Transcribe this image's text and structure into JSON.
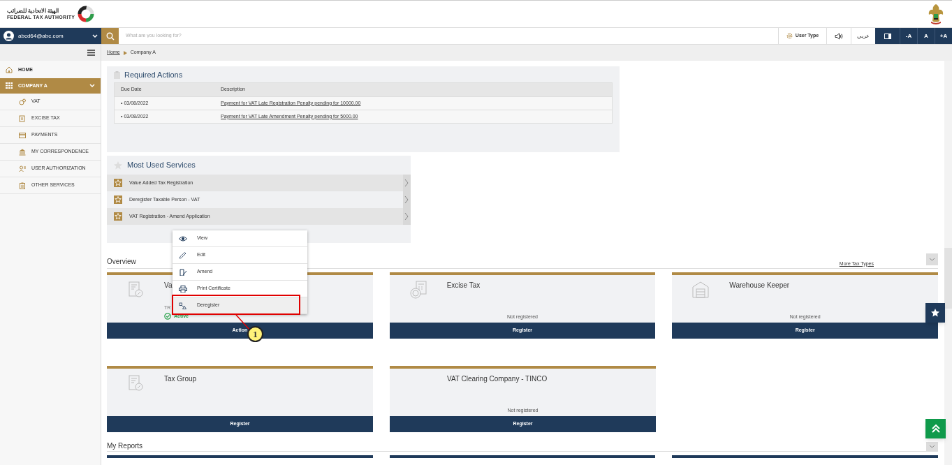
{
  "header": {
    "logo_arabic": "الهيئة الاتحادية للضرائب",
    "logo_english": "FEDERAL TAX AUTHORITY"
  },
  "user": {
    "email": "abcd64@abc.com"
  },
  "search": {
    "placeholder": "What are you looking for?"
  },
  "toolbar": {
    "user_type": "User Type",
    "language": "عربي",
    "font_buttons": [
      "-A",
      "A",
      "+A"
    ]
  },
  "breadcrumb": [
    "Home",
    "Company A"
  ],
  "sidebar": {
    "items": [
      {
        "label": "HOME",
        "selected": false
      },
      {
        "label": "COMPANY A",
        "selected": true,
        "expanded": true,
        "children": [
          {
            "label": "VAT"
          },
          {
            "label": "EXCISE TAX"
          },
          {
            "label": "PAYMENTS"
          },
          {
            "label": "MY CORRESPONDENCE"
          },
          {
            "label": "USER AUTHORIZATION"
          },
          {
            "label": "OTHER SERVICES"
          }
        ]
      }
    ]
  },
  "required_actions": {
    "title": "Required Actions",
    "columns": [
      "Due Date",
      "Description"
    ],
    "rows": [
      {
        "due_date": "• 03/08/2022",
        "description": "Payment for VAT Late Registration Penalty pending for 10000.00"
      },
      {
        "due_date": "• 03/08/2022",
        "description": "Payment for VAT Late Amendment Penalty pending for 5000.00"
      }
    ]
  },
  "most_used_services": {
    "title": "Most Used Services",
    "items": [
      {
        "label": "Value Added Tax Registration"
      },
      {
        "label": "Deregister Taxable Person - VAT"
      },
      {
        "label": "VAT Registration - Amend Application"
      }
    ]
  },
  "overview": {
    "title": "Overview",
    "more_link": "More Tax Types",
    "cards": [
      {
        "title": "Va",
        "trn": "TR",
        "status": "Active",
        "button": "Action"
      },
      {
        "title": "Excise Tax",
        "note": "Not registered",
        "button": "Register"
      },
      {
        "title": "Warehouse Keeper",
        "note": "Not registered",
        "button": "Register"
      },
      {
        "title": "Tax Group",
        "button": "Register"
      },
      {
        "title": "VAT Clearing Company - TINCO",
        "note": "Not registered",
        "button": "Register"
      }
    ]
  },
  "action_menu": {
    "items": [
      {
        "label": "View",
        "selected": false
      },
      {
        "label": "Edit",
        "selected": false
      },
      {
        "label": "Amend",
        "selected": false
      },
      {
        "label": "Print Certificate",
        "selected": false
      },
      {
        "label": "Deregister",
        "selected": true
      }
    ]
  },
  "callout": {
    "number": "1"
  },
  "my_reports": {
    "title": "My Reports"
  }
}
